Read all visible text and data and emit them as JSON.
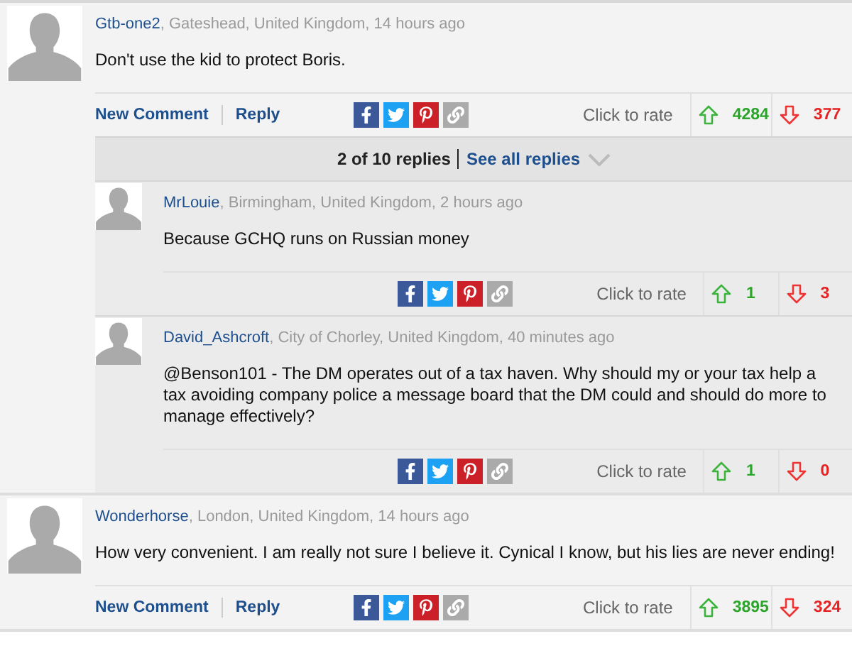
{
  "comments": [
    {
      "author": "Gtb-one2",
      "meta": ", Gateshead, United Kingdom, 14 hours ago",
      "body": "Don't use the kid to protect Boris.",
      "actions": [
        "New Comment",
        "Reply"
      ],
      "rate_label": "Click to rate",
      "up": "4284",
      "down": "377",
      "replies_bar": {
        "count": "2 of 10 replies",
        "link": "See all replies"
      },
      "replies": [
        {
          "author": "MrLouie",
          "meta": ", Birmingham, United Kingdom, 2 hours ago",
          "body": "Because GCHQ runs on Russian money",
          "rate_label": "Click to rate",
          "up": "1",
          "down": "3"
        },
        {
          "author": "David_Ashcroft",
          "meta": ", City of Chorley, United Kingdom, 40 minutes ago",
          "body": "@Benson101 - The DM operates out of a tax haven. Why should my or your tax help a tax avoiding company police a message board that the DM could and should do more to manage effectively?",
          "rate_label": "Click to rate",
          "up": "1",
          "down": "0"
        }
      ]
    },
    {
      "author": "Wonderhorse",
      "meta": ", London, United Kingdom, 14 hours ago",
      "body": "How very convenient. I am really not sure I believe it. Cynical I know, but his lies are never ending!",
      "actions": [
        "New Comment",
        "Reply"
      ],
      "rate_label": "Click to rate",
      "up": "3895",
      "down": "324"
    }
  ]
}
